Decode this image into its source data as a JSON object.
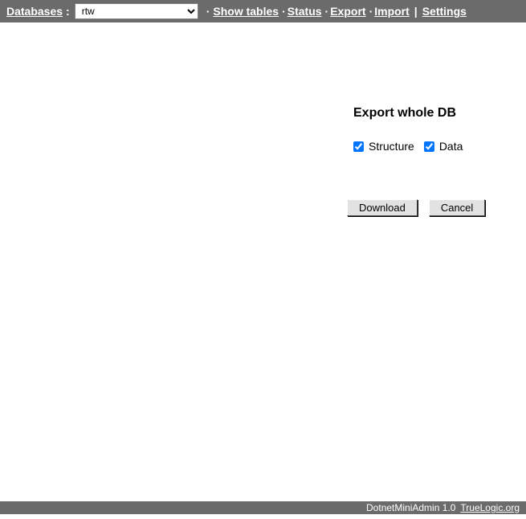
{
  "topbar": {
    "databases_label": "Databases",
    "selected_db": "rtw",
    "links": {
      "show_tables": "Show tables",
      "status": "Status",
      "export": "Export",
      "import": "Import",
      "settings": "Settings"
    }
  },
  "export": {
    "heading": "Export whole DB",
    "structure_label": "Structure",
    "data_label": "Data",
    "structure_checked": true,
    "data_checked": true,
    "download_button": "Download",
    "cancel_button": "Cancel"
  },
  "footer": {
    "app": "DotnetMiniAdmin 1.0",
    "link_text": "TrueLogic.org"
  }
}
